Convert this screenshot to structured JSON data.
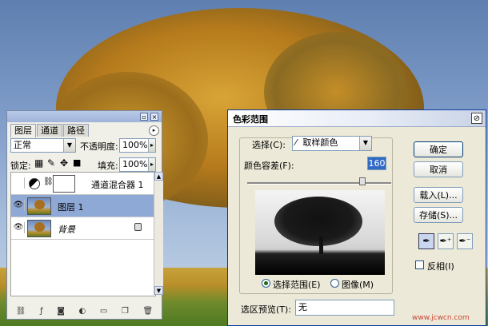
{
  "layers_panel": {
    "tabs": [
      "图层",
      "通道",
      "路径"
    ],
    "blend_mode": "正常",
    "opacity_label": "不透明度:",
    "opacity_value": "100%",
    "lock_label": "锁定:",
    "fill_label": "填充:",
    "fill_value": "100%",
    "layers": [
      {
        "name": "通道混合器 1",
        "visible": false,
        "type": "adjustment",
        "selected": false
      },
      {
        "name": "图层 1",
        "visible": true,
        "type": "image",
        "selected": true
      },
      {
        "name": "背景",
        "visible": true,
        "type": "background",
        "selected": false,
        "locked": true
      }
    ]
  },
  "color_range_dialog": {
    "title": "色彩范围",
    "select_label": "选择(C):",
    "select_value": "取样颜色",
    "fuzziness_label": "颜色容差(F):",
    "fuzziness_value": "160",
    "fuzziness_fraction": 0.8,
    "radio_selection": "选择范围(E)",
    "radio_image": "图像(M)",
    "radio_selected": "selection",
    "selection_preview_label": "选区预览(T):",
    "selection_preview_value": "无",
    "buttons": {
      "ok": "确定",
      "cancel": "取消",
      "load": "载入(L)...",
      "save": "存储(S)..."
    },
    "invert_label": "反相(I)",
    "invert_checked": false
  },
  "watermark": "www.jcwcn.com",
  "colors": {
    "selection": "#8fa9d6",
    "dialog_bg": "#ece9d8",
    "border_blue": "#7f9db9"
  }
}
